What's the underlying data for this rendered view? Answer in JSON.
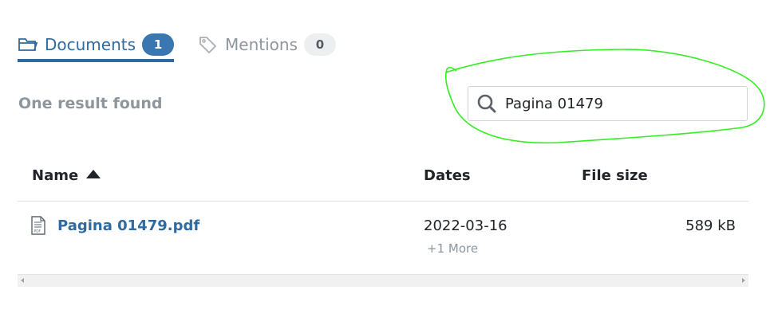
{
  "tabs": [
    {
      "label": "Documents",
      "count": "1",
      "icon": "folder-icon",
      "active": true
    },
    {
      "label": "Mentions",
      "count": "0",
      "icon": "tag-icon",
      "active": false
    }
  ],
  "result_text": "One result found",
  "search": {
    "value": "Pagina 01479",
    "icon": "search-icon"
  },
  "table": {
    "headers": {
      "name": "Name",
      "dates": "Dates",
      "size": "File size"
    },
    "rows": [
      {
        "name": "Pagina 01479.pdf",
        "date": "2022-03-16",
        "more": "+1 More",
        "size": "589 kB",
        "icon": "pdf-file-icon"
      }
    ]
  },
  "colors": {
    "accent": "#2f6b9f",
    "annotation": "#33ee22"
  }
}
